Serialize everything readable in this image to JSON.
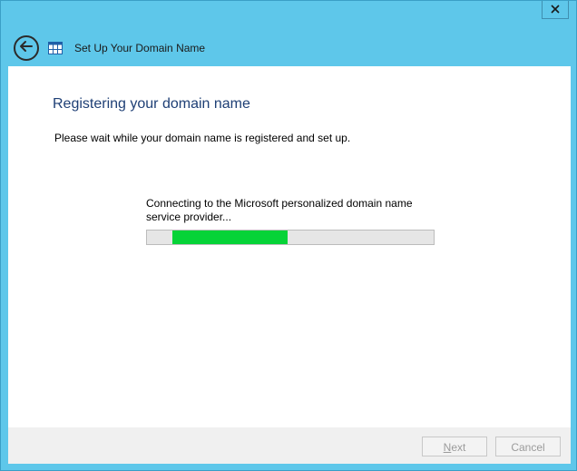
{
  "window": {
    "title": "Set Up Your Domain Name",
    "close_label": "x"
  },
  "icons": {
    "back": "back-arrow-icon",
    "app": "window-grid-icon",
    "close": "close-icon"
  },
  "page": {
    "heading": "Registering your domain name",
    "description": "Please wait while your domain name is registered and set up.",
    "status_text": "Connecting to the Microsoft personalized domain name service provider...",
    "progress": {
      "indeterminate": true,
      "fill_start_fraction": 0.09,
      "fill_end_fraction": 0.49
    }
  },
  "footer": {
    "next_mnemonic": "N",
    "next_rest": "ext",
    "cancel_label": "Cancel"
  },
  "colors": {
    "frame": "#5ec7ea",
    "heading": "#1e3f75",
    "progress_fill": "#06d337",
    "progress_track": "#e6e6e6",
    "footer": "#f0f0f0"
  }
}
